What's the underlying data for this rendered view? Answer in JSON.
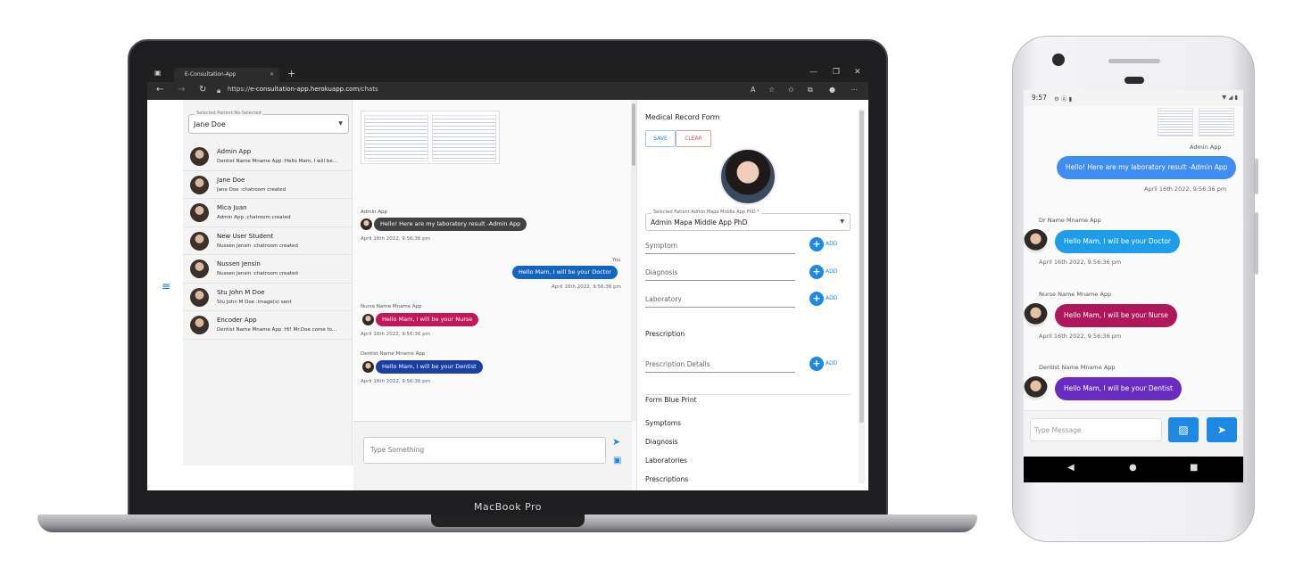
{
  "laptop": {
    "brand": "MacBook Pro",
    "browser": {
      "tab_title": "E-Consultation-App",
      "tab_close": "✕",
      "tab_add": "+",
      "url_scheme": "https://",
      "url_host": "e-consultation-app.herokuapp.com",
      "url_path": "/chats",
      "window_controls": [
        "—",
        "❐",
        "✕"
      ]
    },
    "patient_panel": {
      "select_label": "Selected Patient:No-Selected",
      "select_value": "Jane Doe",
      "contacts": [
        {
          "name": "Admin App",
          "preview": "Dentist Name Mname App :Hello Mam, I will be..."
        },
        {
          "name": "Jane Doe",
          "preview": "Jane Doe :chatroom created"
        },
        {
          "name": "Mica Juan",
          "preview": "Admin App :chatroom created"
        },
        {
          "name": "New User Student",
          "preview": "Nussen Jensin :chatroom created"
        },
        {
          "name": "Nussen Jensin",
          "preview": "Nussen Jensin :chatroom created"
        },
        {
          "name": "Stu John M Doe",
          "preview": "Stu John M Doe :image(s) sent"
        },
        {
          "name": "Encoder App",
          "preview": "Dentist Name Mname App :Hi! Mr.Doe come to..."
        }
      ]
    },
    "chat": {
      "messages": [
        {
          "sender": "Admin App",
          "text": "Hello! Here are my laboratory result -Admin App",
          "time": "April 16th 2022, 9:56:36 pm",
          "color": "#424242"
        },
        {
          "sender": "You",
          "text": "Hello Mam, I will be your Doctor",
          "time": "April 16th 2022, 9:56:36 pm",
          "color": "#1565c0"
        },
        {
          "sender": "Nurse Name Mname App",
          "text": "Hello Mam, I will be your Nurse",
          "time": "April 16th 2022, 9:56:36 pm",
          "color": "#c2185b"
        },
        {
          "sender": "Dentist Name Mname App",
          "text": "Hello Mam, I will be your Dentist",
          "time": "April 16th 2022, 9:56:36 pm",
          "color": "#1a3fa6"
        }
      ],
      "composer_placeholder": "Type Something"
    },
    "record": {
      "title": "Medical Record Form",
      "save_label": "SAVE",
      "clear_label": "CLEAR",
      "patient_label": "Selected Patient:Admin Mapa Middle App PhD *",
      "patient_value": "Admin Mapa Middle App PhD",
      "fields": [
        "Symptom",
        "Diagnosis",
        "Laboratory"
      ],
      "add_label": "ADD",
      "prescription_heading": "Prescription",
      "prescription_field": "Prescription Details",
      "blueprint_heading": "Form Blue Print",
      "blueprint_items": [
        "Symptoms",
        "Diagnosis",
        "Laboratories",
        "Prescriptions"
      ]
    }
  },
  "phone": {
    "time": "9:57",
    "messages": [
      {
        "sender": "Admin App",
        "text": "Hello! Here are my laboratory result -Admin App",
        "time": "April 16th 2022, 9:56:36 pm",
        "color": "#3d8ef0"
      },
      {
        "sender": "Dr Name Mname App",
        "text": "Hello Mam, I will be your Doctor",
        "time": "April 16th 2022, 9:56:36 pm",
        "color": "#1e9de8"
      },
      {
        "sender": "Nurse Name Mname App",
        "text": "Hello Mam, I will be your Nurse",
        "time": "April 16th 2022, 9:56:36 pm",
        "color": "#b0175a"
      },
      {
        "sender": "Dentist Name Mname App",
        "text": "Hello Mam, I will be your Dentist",
        "time": "",
        "color": "#6a2bc2"
      }
    ],
    "composer_placeholder": "Type Message"
  },
  "icons": {
    "hamburger": "menu-icon",
    "send": "send-icon",
    "image": "image-icon",
    "back": "back-icon",
    "home": "home-icon",
    "recents": "recents-icon"
  }
}
